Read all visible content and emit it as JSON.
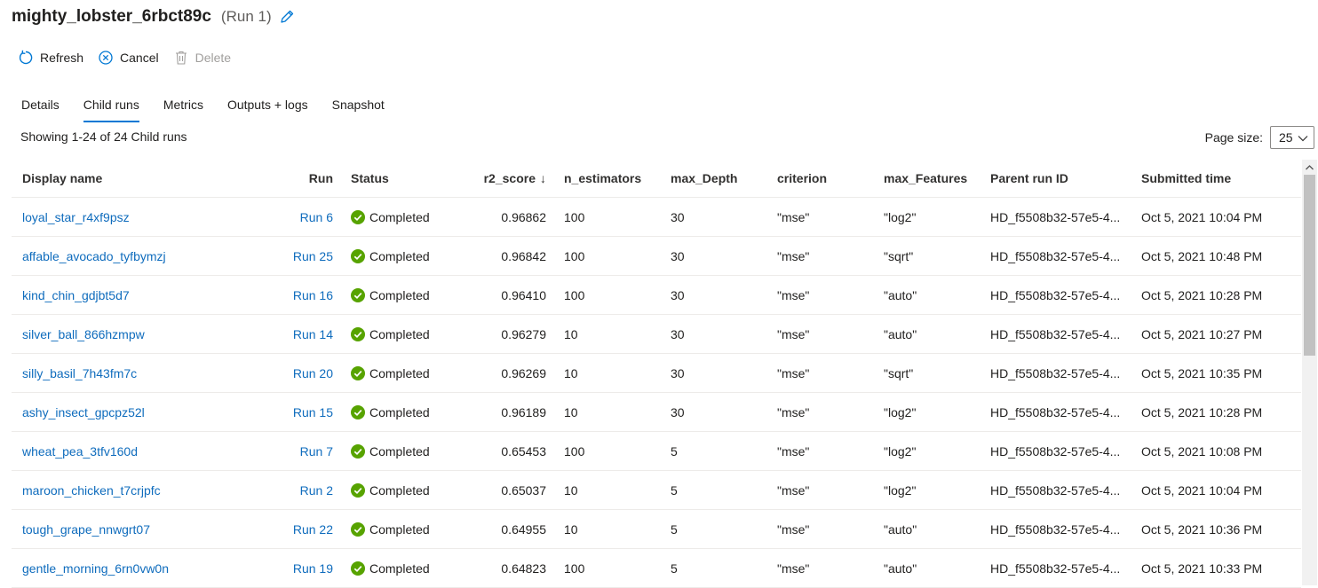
{
  "header": {
    "title": "mighty_lobster_6rbct89c",
    "subtitle": "(Run 1)"
  },
  "toolbar": {
    "refresh": "Refresh",
    "cancel": "Cancel",
    "delete": "Delete"
  },
  "tabs": [
    "Details",
    "Child runs",
    "Metrics",
    "Outputs + logs",
    "Snapshot"
  ],
  "active_tab": "Child runs",
  "summary": "Showing 1-24 of 24 Child runs",
  "page_size": {
    "label": "Page size:",
    "value": "25"
  },
  "columns": {
    "name": "Display name",
    "run": "Run",
    "status": "Status",
    "score": "r2_score",
    "score_sort": "↓",
    "n_estimators": "n_estimators",
    "max_depth": "max_Depth",
    "criterion": "criterion",
    "max_features": "max_Features",
    "parent": "Parent run ID",
    "submitted": "Submitted time"
  },
  "rows": [
    {
      "name": "loyal_star_r4xf9psz",
      "run": "Run 6",
      "status": "Completed",
      "score": "0.96862",
      "n_estimators": "100",
      "max_depth": "30",
      "criterion": "\"mse\"",
      "max_features": "\"log2\"",
      "parent": "HD_f5508b32-57e5-4...",
      "submitted": "Oct 5, 2021 10:04 PM"
    },
    {
      "name": "affable_avocado_tyfbymzj",
      "run": "Run 25",
      "status": "Completed",
      "score": "0.96842",
      "n_estimators": "100",
      "max_depth": "30",
      "criterion": "\"mse\"",
      "max_features": "\"sqrt\"",
      "parent": "HD_f5508b32-57e5-4...",
      "submitted": "Oct 5, 2021 10:48 PM"
    },
    {
      "name": "kind_chin_gdjbt5d7",
      "run": "Run 16",
      "status": "Completed",
      "score": "0.96410",
      "n_estimators": "100",
      "max_depth": "30",
      "criterion": "\"mse\"",
      "max_features": "\"auto\"",
      "parent": "HD_f5508b32-57e5-4...",
      "submitted": "Oct 5, 2021 10:28 PM"
    },
    {
      "name": "silver_ball_866hzmpw",
      "run": "Run 14",
      "status": "Completed",
      "score": "0.96279",
      "n_estimators": "10",
      "max_depth": "30",
      "criterion": "\"mse\"",
      "max_features": "\"auto\"",
      "parent": "HD_f5508b32-57e5-4...",
      "submitted": "Oct 5, 2021 10:27 PM"
    },
    {
      "name": "silly_basil_7h43fm7c",
      "run": "Run 20",
      "status": "Completed",
      "score": "0.96269",
      "n_estimators": "10",
      "max_depth": "30",
      "criterion": "\"mse\"",
      "max_features": "\"sqrt\"",
      "parent": "HD_f5508b32-57e5-4...",
      "submitted": "Oct 5, 2021 10:35 PM"
    },
    {
      "name": "ashy_insect_gpcpz52l",
      "run": "Run 15",
      "status": "Completed",
      "score": "0.96189",
      "n_estimators": "10",
      "max_depth": "30",
      "criterion": "\"mse\"",
      "max_features": "\"log2\"",
      "parent": "HD_f5508b32-57e5-4...",
      "submitted": "Oct 5, 2021 10:28 PM"
    },
    {
      "name": "wheat_pea_3tfv160d",
      "run": "Run 7",
      "status": "Completed",
      "score": "0.65453",
      "n_estimators": "100",
      "max_depth": "5",
      "criterion": "\"mse\"",
      "max_features": "\"log2\"",
      "parent": "HD_f5508b32-57e5-4...",
      "submitted": "Oct 5, 2021 10:08 PM"
    },
    {
      "name": "maroon_chicken_t7crjpfc",
      "run": "Run 2",
      "status": "Completed",
      "score": "0.65037",
      "n_estimators": "10",
      "max_depth": "5",
      "criterion": "\"mse\"",
      "max_features": "\"log2\"",
      "parent": "HD_f5508b32-57e5-4...",
      "submitted": "Oct 5, 2021 10:04 PM"
    },
    {
      "name": "tough_grape_nnwgrt07",
      "run": "Run 22",
      "status": "Completed",
      "score": "0.64955",
      "n_estimators": "10",
      "max_depth": "5",
      "criterion": "\"mse\"",
      "max_features": "\"auto\"",
      "parent": "HD_f5508b32-57e5-4...",
      "submitted": "Oct 5, 2021 10:36 PM"
    },
    {
      "name": "gentle_morning_6rn0vw0n",
      "run": "Run 19",
      "status": "Completed",
      "score": "0.64823",
      "n_estimators": "100",
      "max_depth": "5",
      "criterion": "\"mse\"",
      "max_features": "\"auto\"",
      "parent": "HD_f5508b32-57e5-4...",
      "submitted": "Oct 5, 2021 10:33 PM"
    }
  ],
  "colors": {
    "link": "#0f6cbd",
    "accent": "#0078d4",
    "success": "#57a300"
  }
}
